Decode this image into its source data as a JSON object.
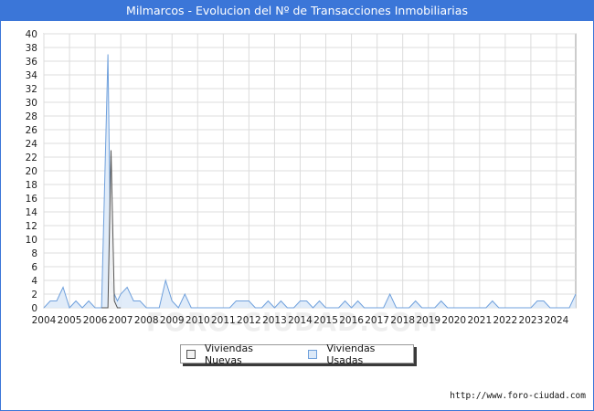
{
  "title": "Milmarcos - Evolucion del Nº de Transacciones Inmobiliarias",
  "source": "http://www.foro-ciudad.com",
  "watermark": "FORO-CIUDAD.COM",
  "colors": {
    "header": "#3b76d8",
    "nuevas_fill": "#f2f2f2",
    "nuevas_line": "#555555",
    "usadas_fill": "#dce9f8",
    "usadas_line": "#6fa0dc",
    "grid": "#dcdcdc"
  },
  "chart_data": {
    "type": "area",
    "title": "Milmarcos - Evolucion del Nº de Transacciones Inmobiliarias",
    "xlabel": "",
    "ylabel": "",
    "xlim": [
      2004,
      2024.75
    ],
    "ylim": [
      0,
      40
    ],
    "x_ticks": [
      "2004",
      "2005",
      "2006",
      "2007",
      "2008",
      "2009",
      "2010",
      "2011",
      "2012",
      "2013",
      "2014",
      "2015",
      "2016",
      "2017",
      "2018",
      "2019",
      "2020",
      "2021",
      "2022",
      "2023",
      "2024"
    ],
    "y_ticks": [
      0,
      2,
      4,
      6,
      8,
      10,
      12,
      14,
      16,
      18,
      20,
      22,
      24,
      26,
      28,
      30,
      32,
      34,
      36,
      38,
      40
    ],
    "grid": true,
    "legend_position": "bottom",
    "series": [
      {
        "name": "Viviendas Nuevas",
        "x": [
          2006.25,
          2006.5,
          2006.62,
          2006.75,
          2006.87,
          2007.0
        ],
        "y": [
          0,
          0,
          23,
          1,
          0,
          0
        ]
      },
      {
        "name": "Viviendas Usadas",
        "x": [
          2004.0,
          2004.25,
          2004.5,
          2004.75,
          2005.0,
          2005.25,
          2005.5,
          2005.75,
          2006.0,
          2006.25,
          2006.5,
          2006.62,
          2006.75,
          2006.87,
          2007.0,
          2007.25,
          2007.5,
          2007.75,
          2008.0,
          2008.25,
          2008.5,
          2008.75,
          2009.0,
          2009.25,
          2009.5,
          2009.75,
          2010.0,
          2010.25,
          2010.5,
          2010.75,
          2011.0,
          2011.25,
          2011.5,
          2011.75,
          2012.0,
          2012.25,
          2012.5,
          2012.75,
          2013.0,
          2013.25,
          2013.5,
          2013.75,
          2014.0,
          2014.25,
          2014.5,
          2014.75,
          2015.0,
          2015.25,
          2015.5,
          2015.75,
          2016.0,
          2016.25,
          2016.5,
          2016.75,
          2017.0,
          2017.25,
          2017.5,
          2017.75,
          2018.0,
          2018.25,
          2018.5,
          2018.75,
          2019.0,
          2019.25,
          2019.5,
          2019.75,
          2020.0,
          2020.25,
          2020.5,
          2020.75,
          2021.0,
          2021.25,
          2021.5,
          2021.75,
          2022.0,
          2022.25,
          2022.5,
          2022.75,
          2023.0,
          2023.25,
          2023.5,
          2023.75,
          2024.0,
          2024.25,
          2024.5,
          2024.75
        ],
        "y": [
          0,
          1,
          1,
          3,
          0,
          1,
          0,
          1,
          0,
          0,
          37,
          4,
          2,
          1,
          2,
          3,
          1,
          1,
          0,
          0,
          0,
          4,
          1,
          0,
          2,
          0,
          0,
          0,
          0,
          0,
          0,
          0,
          1,
          1,
          1,
          0,
          0,
          1,
          0,
          1,
          0,
          0,
          1,
          1,
          0,
          1,
          0,
          0,
          0,
          1,
          0,
          1,
          0,
          0,
          0,
          0,
          2,
          0,
          0,
          0,
          1,
          0,
          0,
          0,
          1,
          0,
          0,
          0,
          0,
          0,
          0,
          0,
          1,
          0,
          0,
          0,
          0,
          0,
          0,
          1,
          1,
          0,
          0,
          0,
          0,
          2
        ]
      }
    ]
  }
}
